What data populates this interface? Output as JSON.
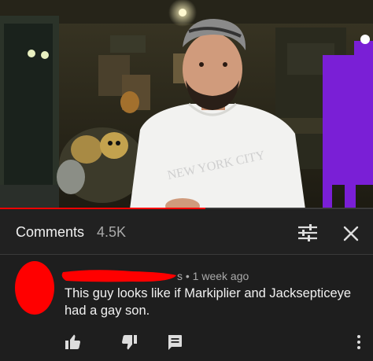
{
  "video": {
    "thumbnail_icon": "video-frame",
    "shirt_text": "NEW YORK CITY",
    "progress_fraction": 0.55
  },
  "comments_panel": {
    "title": "Comments",
    "count": "4.5K",
    "sort_icon": "sort-icon",
    "close_icon": "close-icon"
  },
  "comment": {
    "author_redacted": true,
    "meta": "s • 1 week ago",
    "text": "This guy looks like if Markiplier and Jacksepticeye had a gay son.",
    "actions": {
      "like_icon": "thumb-up-icon",
      "dislike_icon": "thumb-down-icon",
      "reply_icon": "reply-icon",
      "more_icon": "more-vert-icon"
    }
  },
  "colors": {
    "background": "#1e1e1e",
    "header_bg": "#212121",
    "text_primary": "#f1f1f1",
    "text_secondary": "#aaaaaa",
    "redaction": "#ff0000",
    "purple_figure": "#7a1fd6"
  }
}
